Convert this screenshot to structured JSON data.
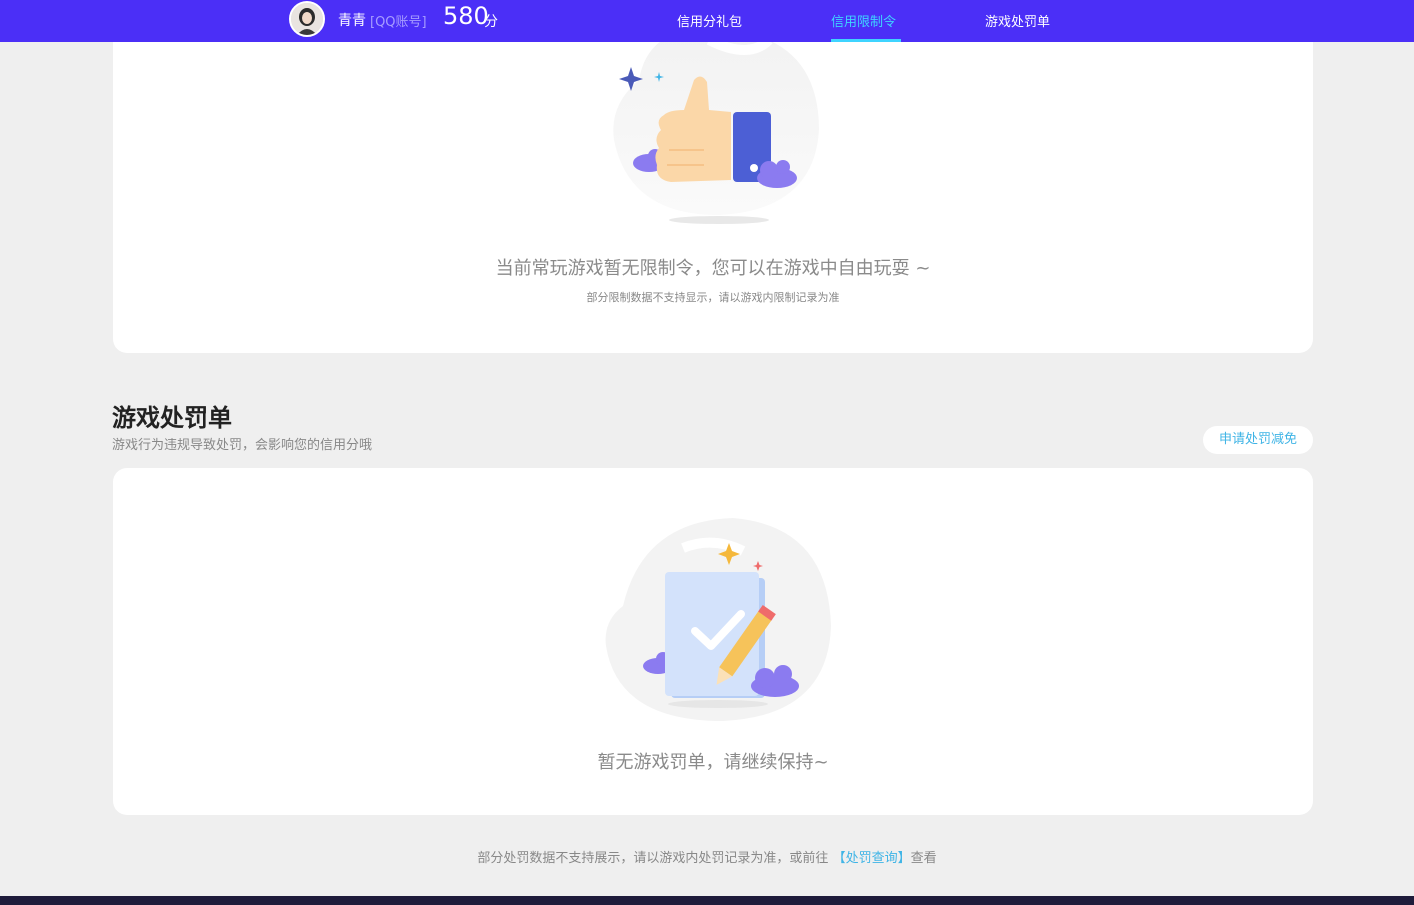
{
  "header": {
    "user_name": "青青",
    "account_label": "[QQ账号]",
    "score": "580",
    "score_unit": "分",
    "nav": [
      {
        "label": "信用分礼包"
      },
      {
        "label": "信用限制令"
      },
      {
        "label": "游戏处罚单"
      }
    ],
    "active_nav": "信用限制令",
    "accent_color": "#4b2ff7",
    "active_color": "#3fd4ff"
  },
  "restriction": {
    "message": "当前常玩游戏暂无限制令，您可以在游戏中自由玩耍 ~",
    "note": "部分限制数据不支持显示，请以游戏内限制记录为准"
  },
  "penalty": {
    "title": "游戏处罚单",
    "description": "游戏行为违规导致处罚，会影响您的信用分哦",
    "apply_button": "申请处罚减免",
    "message": "暂无游戏罚单，请继续保持~"
  },
  "footer": {
    "note_prefix": "部分处罚数据不支持展示，请以游戏内处罚记录为准，或前往",
    "link": "【处罚查询】",
    "note_suffix": "查看"
  }
}
